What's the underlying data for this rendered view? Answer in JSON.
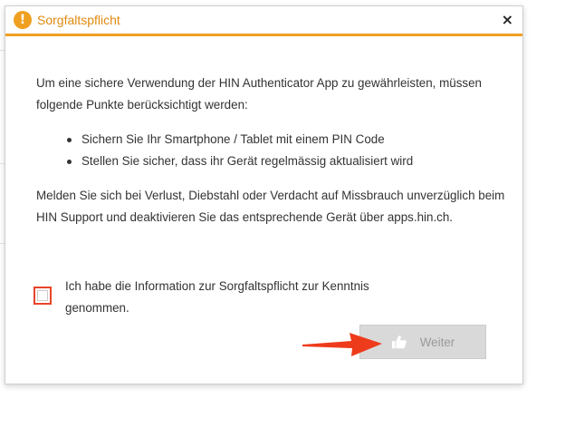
{
  "dialog": {
    "title": "Sorgfaltspflicht",
    "close_glyph": "×",
    "warning_icon": "!",
    "intro": "Um eine sichere Verwendung der HIN Authenticator App zu gewährleisten, müssen folgende Punkte berücksichtigt werden:",
    "bullets": [
      "Sichern Sie Ihr Smartphone / Tablet mit einem PIN Code",
      "Stellen Sie sicher, dass ihr Gerät regelmässig aktualisiert wird"
    ],
    "support_text": "Melden Sie sich bei Verlust, Diebstahl oder Verdacht auf Missbrauch unverzüglich beim HIN Support und deaktivieren Sie das entsprechende Gerät über apps.hin.ch.",
    "consent_label": "Ich habe die Information zur Sorgfaltspflicht zur Kenntnis genommen.",
    "consent_checked": false,
    "continue_button": {
      "label": "Weiter",
      "icon": "thumbs-up-icon",
      "disabled": true
    }
  },
  "colors": {
    "accent_orange": "#f0a020",
    "title_orange": "#e08a10",
    "highlight_red": "#e8442a",
    "disabled_button": "#d9d9d9"
  }
}
